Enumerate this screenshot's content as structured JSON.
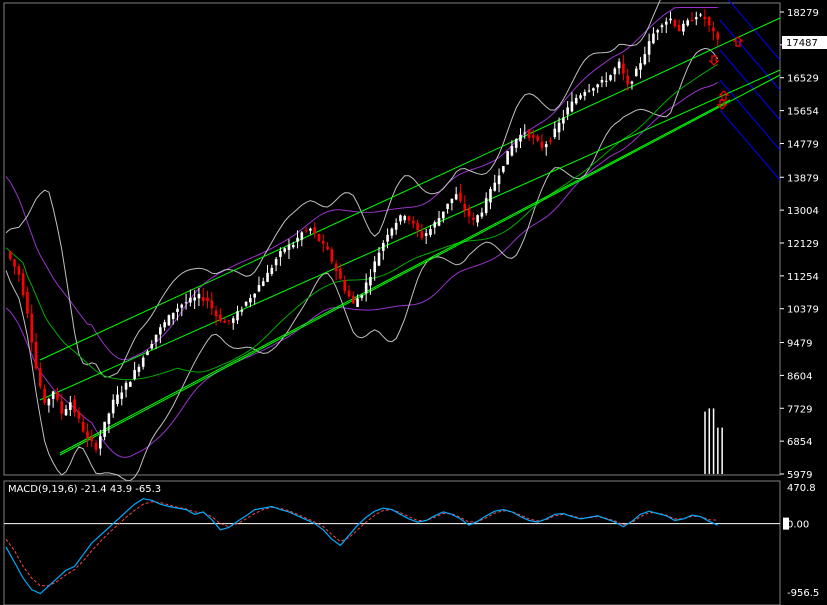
{
  "chart_data": {
    "type": "candlestick",
    "main_panel": {
      "y_ticks": [
        "18279",
        "17404",
        "16529",
        "15654",
        "14779",
        "13879",
        "13004",
        "12129",
        "11254",
        "10379",
        "9479",
        "8604",
        "7729",
        "6854",
        "5979"
      ],
      "ylim": [
        5979,
        18279
      ],
      "last_price_label": "17487",
      "last_price": 17487,
      "price_path": [
        [
          0,
          11900
        ],
        [
          3,
          11300
        ],
        [
          5,
          10300
        ],
        [
          7,
          8800
        ],
        [
          9,
          7800
        ],
        [
          11,
          8200
        ],
        [
          13,
          7600
        ],
        [
          15,
          7900
        ],
        [
          17,
          7400
        ],
        [
          19,
          6900
        ],
        [
          21,
          6700
        ],
        [
          23,
          7300
        ],
        [
          25,
          7900
        ],
        [
          27,
          8200
        ],
        [
          29,
          8500
        ],
        [
          31,
          8900
        ],
        [
          33,
          9300
        ],
        [
          35,
          9700
        ],
        [
          37,
          10000
        ],
        [
          39,
          10300
        ],
        [
          41,
          10500
        ],
        [
          43,
          10600
        ],
        [
          45,
          10700
        ],
        [
          47,
          10600
        ],
        [
          49,
          10200
        ],
        [
          51,
          10000
        ],
        [
          53,
          10100
        ],
        [
          55,
          10400
        ],
        [
          57,
          10700
        ],
        [
          59,
          11000
        ],
        [
          61,
          11300
        ],
        [
          63,
          11700
        ],
        [
          65,
          12000
        ],
        [
          67,
          12100
        ],
        [
          69,
          12400
        ],
        [
          71,
          12500
        ],
        [
          73,
          12200
        ],
        [
          75,
          11900
        ],
        [
          77,
          11400
        ],
        [
          79,
          10900
        ],
        [
          81,
          10500
        ],
        [
          83,
          10800
        ],
        [
          85,
          11300
        ],
        [
          87,
          11900
        ],
        [
          89,
          12400
        ],
        [
          91,
          12700
        ],
        [
          93,
          12900
        ],
        [
          95,
          12600
        ],
        [
          97,
          12300
        ],
        [
          99,
          12500
        ],
        [
          101,
          12800
        ],
        [
          103,
          13200
        ],
        [
          105,
          13400
        ],
        [
          107,
          13000
        ],
        [
          109,
          12700
        ],
        [
          111,
          13000
        ],
        [
          113,
          13500
        ],
        [
          115,
          14000
        ],
        [
          117,
          14500
        ],
        [
          119,
          14900
        ],
        [
          121,
          15100
        ],
        [
          123,
          14900
        ],
        [
          125,
          14700
        ],
        [
          127,
          14900
        ],
        [
          129,
          15300
        ],
        [
          131,
          15700
        ],
        [
          133,
          16000
        ],
        [
          135,
          16200
        ],
        [
          137,
          16300
        ],
        [
          139,
          16400
        ],
        [
          141,
          16600
        ],
        [
          143,
          16900
        ],
        [
          145,
          16300
        ],
        [
          147,
          16700
        ],
        [
          149,
          17200
        ],
        [
          151,
          17700
        ],
        [
          153,
          18000
        ],
        [
          155,
          18100
        ],
        [
          157,
          17800
        ],
        [
          159,
          18000
        ],
        [
          161,
          18200
        ],
        [
          163,
          18100
        ],
        [
          165,
          17700
        ],
        [
          166,
          17487
        ]
      ],
      "volume_bars": [
        [
          163,
          780
        ],
        [
          164,
          820
        ],
        [
          165,
          820
        ],
        [
          166,
          580
        ],
        [
          167,
          580
        ]
      ]
    },
    "macd_panel": {
      "label": "MACD(9,19,6) -21.4 43.9 -65.3",
      "params": [
        9,
        19,
        6
      ],
      "values": {
        "macd": -21.4,
        "signal": 43.9,
        "histogram": -65.3
      },
      "y_ticks": [
        "470.8",
        "0.00",
        "-956.5"
      ],
      "ylim": [
        -956.5,
        470.8
      ],
      "macd_line": [
        [
          0,
          -300
        ],
        [
          2,
          -500
        ],
        [
          4,
          -700
        ],
        [
          6,
          -850
        ],
        [
          8,
          -900
        ],
        [
          10,
          -800
        ],
        [
          12,
          -700
        ],
        [
          14,
          -600
        ],
        [
          16,
          -550
        ],
        [
          18,
          -400
        ],
        [
          20,
          -250
        ],
        [
          22,
          -150
        ],
        [
          24,
          -50
        ],
        [
          26,
          50
        ],
        [
          28,
          150
        ],
        [
          30,
          250
        ],
        [
          32,
          320
        ],
        [
          34,
          300
        ],
        [
          36,
          250
        ],
        [
          38,
          220
        ],
        [
          40,
          200
        ],
        [
          42,
          180
        ],
        [
          44,
          120
        ],
        [
          46,
          150
        ],
        [
          48,
          50
        ],
        [
          50,
          -80
        ],
        [
          52,
          -50
        ],
        [
          54,
          30
        ],
        [
          56,
          100
        ],
        [
          58,
          180
        ],
        [
          60,
          200
        ],
        [
          62,
          220
        ],
        [
          64,
          180
        ],
        [
          66,
          150
        ],
        [
          68,
          100
        ],
        [
          70,
          50
        ],
        [
          72,
          0
        ],
        [
          74,
          -80
        ],
        [
          76,
          -200
        ],
        [
          78,
          -280
        ],
        [
          80,
          -150
        ],
        [
          82,
          -20
        ],
        [
          84,
          80
        ],
        [
          86,
          160
        ],
        [
          88,
          200
        ],
        [
          90,
          180
        ],
        [
          92,
          120
        ],
        [
          94,
          60
        ],
        [
          96,
          20
        ],
        [
          98,
          40
        ],
        [
          100,
          100
        ],
        [
          102,
          150
        ],
        [
          104,
          120
        ],
        [
          106,
          60
        ],
        [
          108,
          -20
        ],
        [
          110,
          30
        ],
        [
          112,
          100
        ],
        [
          114,
          160
        ],
        [
          116,
          180
        ],
        [
          118,
          150
        ],
        [
          120,
          90
        ],
        [
          122,
          40
        ],
        [
          124,
          20
        ],
        [
          126,
          60
        ],
        [
          128,
          120
        ],
        [
          130,
          130
        ],
        [
          132,
          90
        ],
        [
          134,
          60
        ],
        [
          136,
          80
        ],
        [
          138,
          100
        ],
        [
          140,
          60
        ],
        [
          142,
          20
        ],
        [
          144,
          -40
        ],
        [
          146,
          30
        ],
        [
          148,
          120
        ],
        [
          150,
          160
        ],
        [
          152,
          130
        ],
        [
          154,
          100
        ],
        [
          156,
          40
        ],
        [
          158,
          60
        ],
        [
          160,
          110
        ],
        [
          162,
          90
        ],
        [
          164,
          30
        ],
        [
          166,
          -21
        ]
      ],
      "signal_line": [
        [
          0,
          -200
        ],
        [
          2,
          -350
        ],
        [
          4,
          -550
        ],
        [
          6,
          -700
        ],
        [
          8,
          -800
        ],
        [
          10,
          -800
        ],
        [
          12,
          -740
        ],
        [
          14,
          -660
        ],
        [
          16,
          -590
        ],
        [
          18,
          -480
        ],
        [
          20,
          -350
        ],
        [
          22,
          -230
        ],
        [
          24,
          -120
        ],
        [
          26,
          -20
        ],
        [
          28,
          80
        ],
        [
          30,
          170
        ],
        [
          32,
          250
        ],
        [
          34,
          280
        ],
        [
          36,
          270
        ],
        [
          38,
          240
        ],
        [
          40,
          210
        ],
        [
          42,
          190
        ],
        [
          44,
          150
        ],
        [
          46,
          140
        ],
        [
          48,
          90
        ],
        [
          50,
          0
        ],
        [
          52,
          -40
        ],
        [
          54,
          0
        ],
        [
          56,
          60
        ],
        [
          58,
          130
        ],
        [
          60,
          180
        ],
        [
          62,
          210
        ],
        [
          64,
          195
        ],
        [
          66,
          165
        ],
        [
          68,
          120
        ],
        [
          70,
          70
        ],
        [
          72,
          20
        ],
        [
          74,
          -40
        ],
        [
          76,
          -140
        ],
        [
          78,
          -230
        ],
        [
          80,
          -180
        ],
        [
          82,
          -80
        ],
        [
          84,
          20
        ],
        [
          86,
          110
        ],
        [
          88,
          170
        ],
        [
          90,
          180
        ],
        [
          92,
          140
        ],
        [
          94,
          90
        ],
        [
          96,
          40
        ],
        [
          98,
          40
        ],
        [
          100,
          80
        ],
        [
          102,
          130
        ],
        [
          104,
          125
        ],
        [
          106,
          80
        ],
        [
          108,
          20
        ],
        [
          110,
          25
        ],
        [
          112,
          75
        ],
        [
          114,
          135
        ],
        [
          116,
          165
        ],
        [
          118,
          155
        ],
        [
          120,
          110
        ],
        [
          122,
          60
        ],
        [
          124,
          35
        ],
        [
          126,
          50
        ],
        [
          128,
          100
        ],
        [
          130,
          120
        ],
        [
          132,
          100
        ],
        [
          134,
          70
        ],
        [
          136,
          75
        ],
        [
          138,
          90
        ],
        [
          140,
          70
        ],
        [
          142,
          35
        ],
        [
          144,
          -15
        ],
        [
          146,
          15
        ],
        [
          148,
          90
        ],
        [
          150,
          140
        ],
        [
          152,
          135
        ],
        [
          154,
          110
        ],
        [
          156,
          60
        ],
        [
          158,
          60
        ],
        [
          160,
          95
        ],
        [
          162,
          90
        ],
        [
          164,
          50
        ],
        [
          166,
          43.9
        ]
      ]
    },
    "colors": {
      "background": "#000000",
      "up_candle": "#ffffff",
      "down_candle": "#ff0000",
      "channel_lines": "#00ff00",
      "envelope_bands": "#9933cc",
      "bollinger_bands": "#c0c0c0",
      "moving_average": "#00aa00",
      "fan_lines": "#0000ff",
      "macd_line": "#00aaff",
      "signal_line": "#ff4444",
      "axis_text": "#ffffff",
      "arrow_markers": "#ff0000"
    }
  }
}
